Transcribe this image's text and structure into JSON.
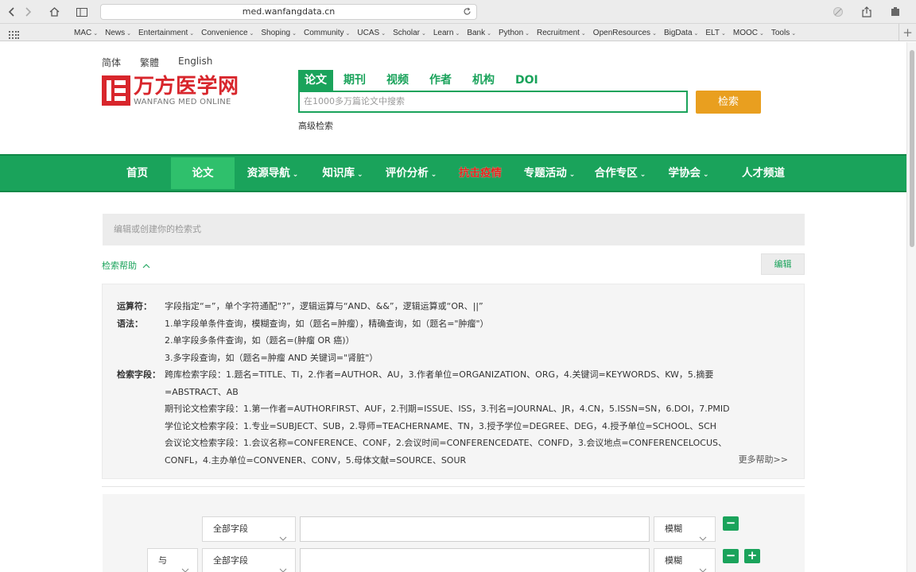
{
  "browser": {
    "url": "med.wanfangdata.cn",
    "bookmarks": [
      "MAC",
      "News",
      "Entertainment",
      "Convenience",
      "Shoping",
      "Community",
      "UCAS",
      "Scholar",
      "Learn",
      "Bank",
      "Python",
      "Recruitment",
      "OpenResources",
      "BigData",
      "ELT",
      "MOOC",
      "Tools"
    ]
  },
  "languages": [
    "简体",
    "繁體",
    "English"
  ],
  "logo": {
    "cn": "万方医学网",
    "en": "WANFANG MED ONLINE"
  },
  "search": {
    "tabs": [
      "论文",
      "期刊",
      "视频",
      "作者",
      "机构",
      "DOI"
    ],
    "active_tab": "论文",
    "placeholder": "在1000多万篇论文中搜索",
    "button": "检索",
    "advanced": "高级检索"
  },
  "nav": {
    "items": [
      {
        "label": "首页",
        "dropdown": false
      },
      {
        "label": "论文",
        "dropdown": false,
        "active": true
      },
      {
        "label": "资源导航",
        "dropdown": true
      },
      {
        "label": "知识库",
        "dropdown": true
      },
      {
        "label": "评价分析",
        "dropdown": true
      },
      {
        "label": "抗击疫情",
        "dropdown": false,
        "highlight": true
      },
      {
        "label": "专题活动",
        "dropdown": true
      },
      {
        "label": "合作专区",
        "dropdown": true
      },
      {
        "label": "学协会",
        "dropdown": true
      },
      {
        "label": "人才频道",
        "dropdown": false
      }
    ]
  },
  "expression": {
    "placeholder": "编辑或创建你的检索式"
  },
  "help": {
    "toggle": "检索帮助",
    "edit": "编辑",
    "operators_label": "运算符：",
    "operators": "字段指定“=”，单个字符通配“?”，逻辑运算与“AND、&&”，逻辑运算或“OR、||”",
    "syntax_label": "语法：",
    "syntax": [
      "1.单字段单条件查询，模糊查询，如（题名=肿瘤），精确查询，如（题名=\"肿瘤\"）",
      "2.单字段多条件查询，如（题名=(肿瘤 OR 癌)）",
      "3.多字段查询，如（题名=肿瘤 AND 关键词=\"肾脏\"）"
    ],
    "fields_label": "检索字段：",
    "fields": [
      "跨库检索字段：1.题名=TITLE、TI，2.作者=AUTHOR、AU，3.作者单位=ORGANIZATION、ORG，4.关键词=KEYWORDS、KW，5.摘要",
      "=ABSTRACT、AB",
      "期刊论文检索字段：1.第一作者=AUTHORFIRST、AUF，2.刊期=ISSUE、ISS，3.刊名=JOURNAL、JR，4.CN，5.ISSN=SN，6.DOI，7.PMID",
      "学位论文检索字段：1.专业=SUBJECT、SUB，2.导师=TEACHERNAME、TN，3.授予学位=DEGREE、DEG，4.授予单位=SCHOOL、SCH",
      "会议论文检索字段：1.会议名称=CONFERENCE、CONF，2.会议时间=CONFERENCEDATE、CONFD，3.会议地点=CONFERENCELOCUS、",
      "CONFL，4.主办单位=CONVENER、CONV，5.母体文献=SOURCE、SOUR"
    ],
    "more": "更多帮助>>"
  },
  "form": {
    "row1": {
      "field": "全部字段",
      "match": "模糊"
    },
    "row2": {
      "logic": "与",
      "field": "全部字段",
      "match": "模糊"
    }
  },
  "colors": {
    "brand_green": "#1aa35b",
    "brand_red": "#d8262c",
    "search_orange": "#e99f1f"
  }
}
